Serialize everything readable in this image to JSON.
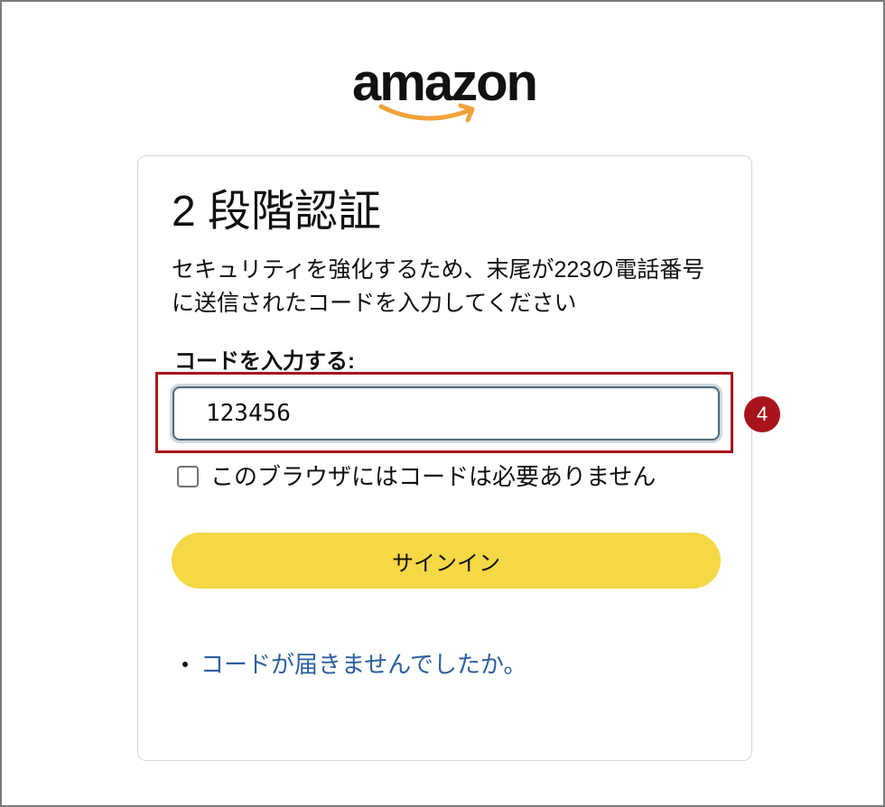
{
  "logo": {
    "text": "amazon",
    "icon": "smile-arrow-icon"
  },
  "page": {
    "title": "2 段階認証",
    "description": "セキュリティを強化するため、末尾が223の電話番号に送信されたコードを入力してください",
    "code_field": {
      "label": "コードを入力する:",
      "value": "123456"
    },
    "remember_device": {
      "label": "このブラウザにはコードは必要ありません",
      "checked": false
    },
    "submit_button": {
      "label": "サインイン"
    },
    "help_links": [
      {
        "label": "コードが届きませんでしたか。"
      }
    ]
  },
  "annotation": {
    "step_number": "4"
  },
  "colors": {
    "button_yellow": "#f5d845",
    "link_blue": "#2c5f9e",
    "annotation_red": "#a8141c",
    "logo_orange": "#f0a23b"
  }
}
